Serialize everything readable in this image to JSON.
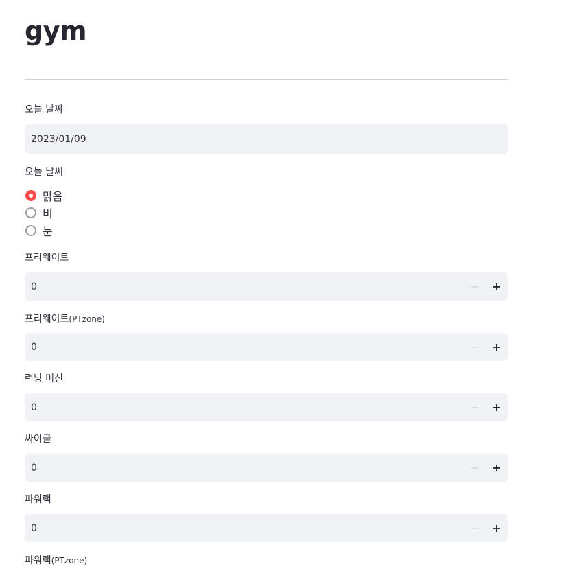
{
  "page": {
    "title": "gym"
  },
  "date_field": {
    "label": "오늘 날짜",
    "value": "2023/01/09"
  },
  "weather": {
    "label": "오늘 날씨",
    "options": [
      "맑음",
      "비",
      "눈"
    ],
    "selected": "맑음"
  },
  "number_inputs": [
    {
      "label": "프리웨이트",
      "label_suffix": "",
      "value": "0"
    },
    {
      "label": "프리웨이트",
      "label_suffix": "(PTzone)",
      "value": "0"
    },
    {
      "label": "런닝 머신",
      "label_suffix": "",
      "value": "0"
    },
    {
      "label": "싸이클",
      "label_suffix": "",
      "value": "0"
    },
    {
      "label": "파워랙",
      "label_suffix": "",
      "value": "0"
    }
  ],
  "last_label": {
    "label": "파워랙",
    "label_suffix": "(PTzone)"
  },
  "stepper": {
    "minus": "−",
    "plus": "+"
  },
  "colors": {
    "accent": "#ff4b4b",
    "input_bg": "#f0f2f6",
    "text": "#31333f"
  }
}
